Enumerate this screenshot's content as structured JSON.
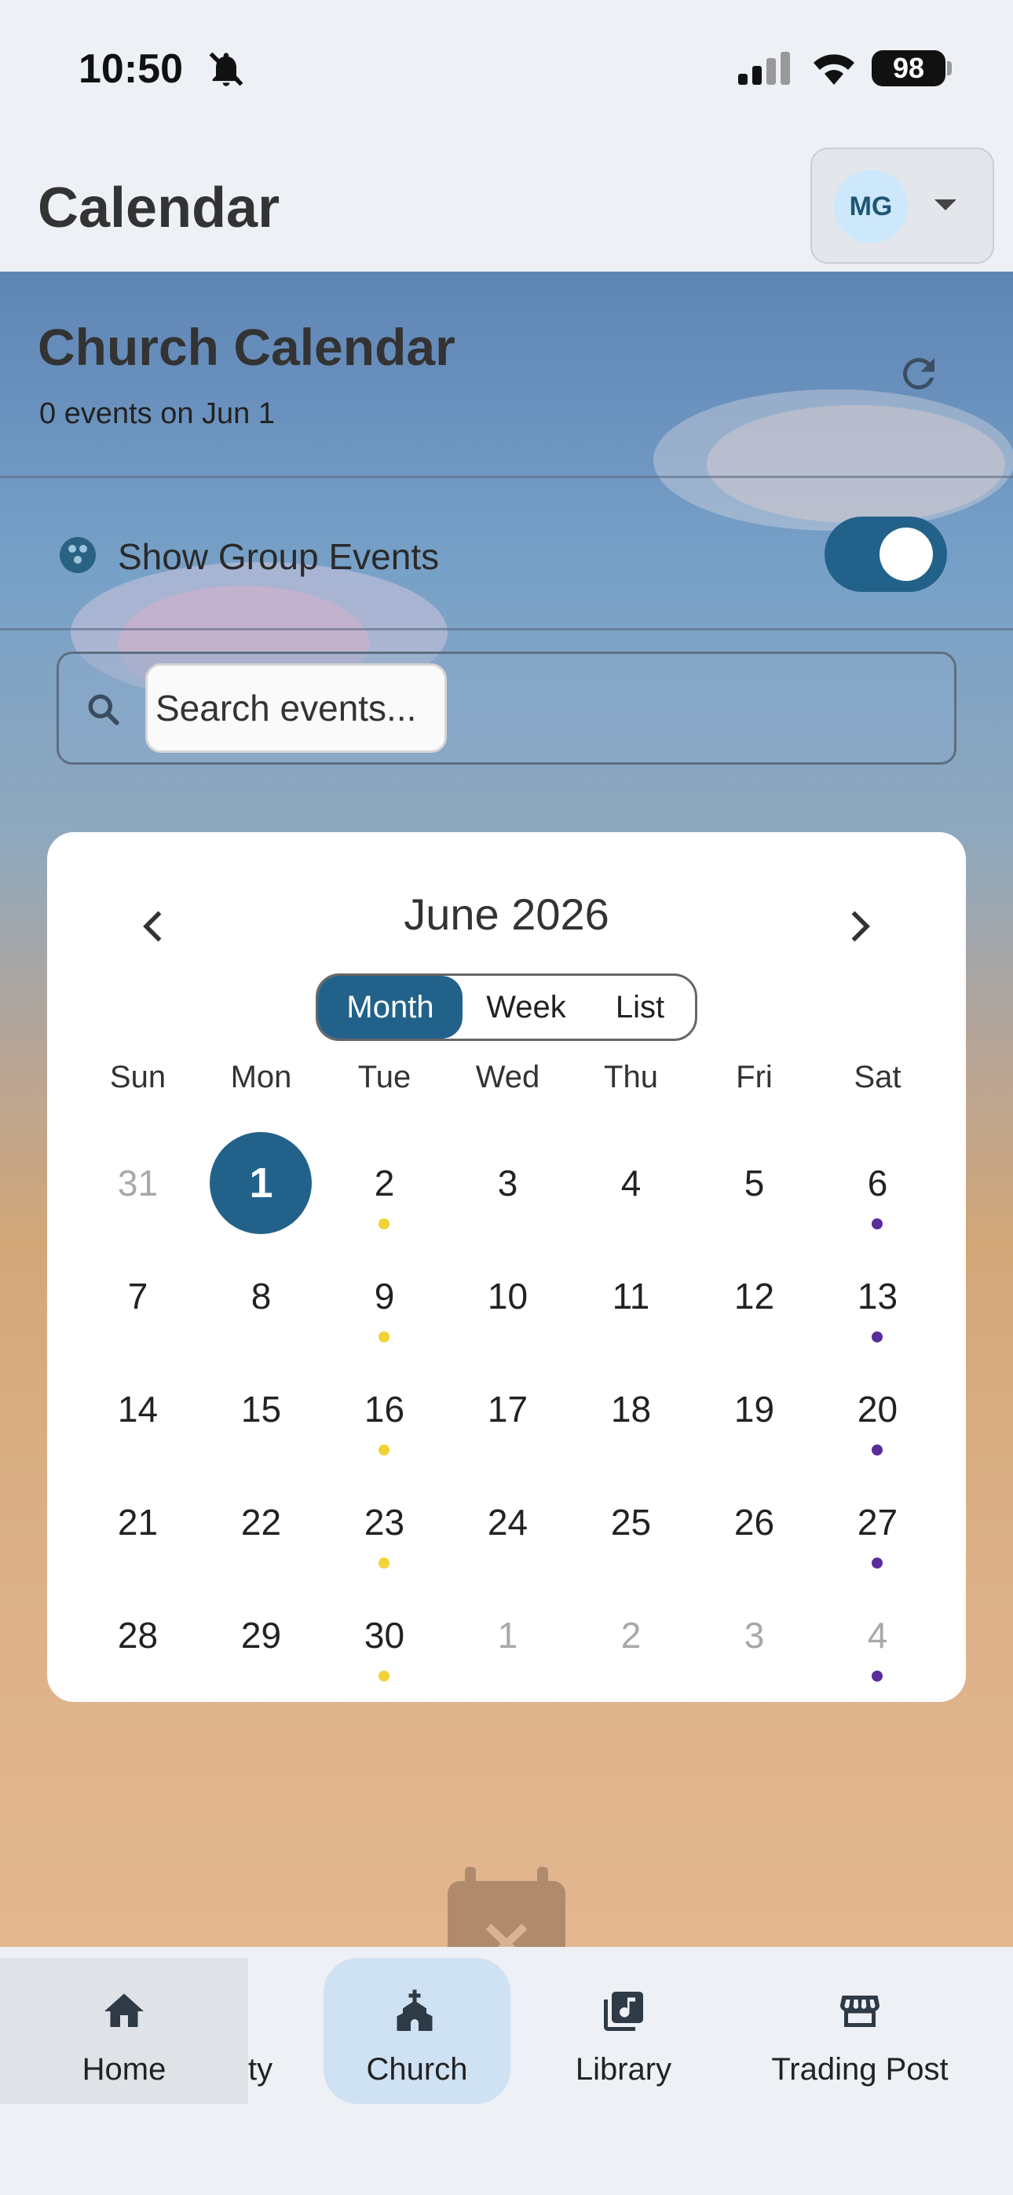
{
  "status_bar": {
    "time": "10:50",
    "battery": "98"
  },
  "header": {
    "title": "Calendar",
    "user_initials": "MG"
  },
  "section": {
    "title": "Church Calendar",
    "subtitle": "0 events on Jun 1"
  },
  "toggle": {
    "label": "Show Group Events",
    "on": true
  },
  "search": {
    "placeholder": "Search events..."
  },
  "calendar": {
    "month_title": "June 2026",
    "views": [
      "Month",
      "Week",
      "List"
    ],
    "active_view": "Month",
    "weekdays": [
      "Sun",
      "Mon",
      "Tue",
      "Wed",
      "Thu",
      "Fri",
      "Sat"
    ],
    "weeks": [
      [
        "31",
        "1",
        "2",
        "3",
        "4",
        "5",
        "6"
      ],
      [
        "7",
        "8",
        "9",
        "10",
        "11",
        "12",
        "13"
      ],
      [
        "14",
        "15",
        "16",
        "17",
        "18",
        "19",
        "20"
      ],
      [
        "21",
        "22",
        "23",
        "24",
        "25",
        "26",
        "27"
      ],
      [
        "28",
        "29",
        "30",
        "1",
        "2",
        "3",
        "4"
      ]
    ],
    "selected_day": "1",
    "event_dot_colors": {
      "tuesday": "#f2d337",
      "saturday": "#5b2d9a"
    }
  },
  "bottom_nav": {
    "items": [
      {
        "label": "Home",
        "icon": "home-icon"
      },
      {
        "label": "ty",
        "icon": ""
      },
      {
        "label": "Church",
        "icon": "church-icon"
      },
      {
        "label": "Library",
        "icon": "library-music-icon"
      },
      {
        "label": "Trading Post",
        "icon": "storefront-icon"
      }
    ],
    "active": "Church"
  },
  "colors": {
    "accent": "#22628a",
    "avatar_bg": "#cde7fb"
  }
}
